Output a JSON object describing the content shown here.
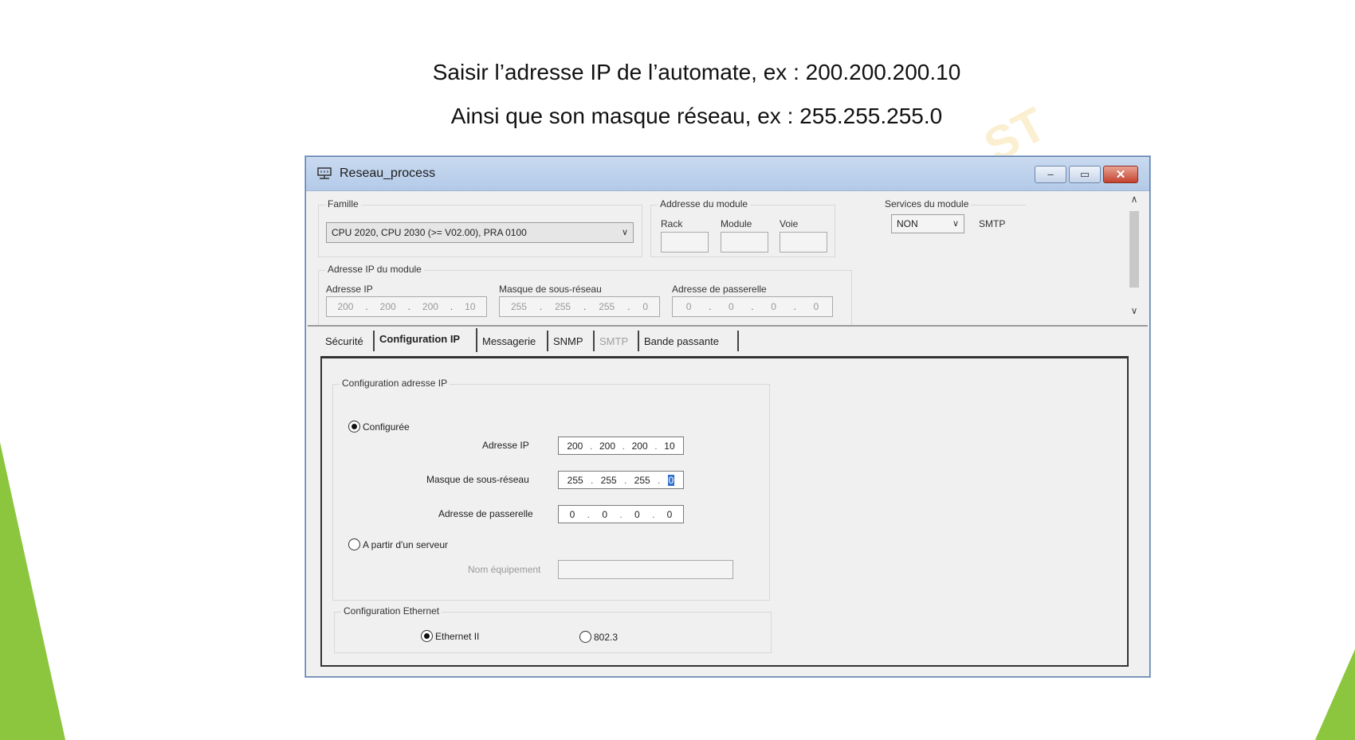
{
  "captions": {
    "line1": "Saisir l’adresse IP de l’automate, ex : 200.200.200.10",
    "line2": "Ainsi que son masque réseau, ex : 255.255.255.0"
  },
  "window": {
    "title": "Reseau_process",
    "title_icon": "network-icon",
    "controls": {
      "minimize": "–",
      "maximize": "▭",
      "close": "✕"
    }
  },
  "module": {
    "famille_label": "Famille",
    "famille_value": "CPU 2020, CPU 2030 (>= V02.00), PRA 0100",
    "addr_label": "Addresse du module",
    "rack_label": "Rack",
    "module_label": "Module",
    "voie_label": "Voie",
    "services_label": "Services du module",
    "services_value": "NON",
    "smtp_label": "SMTP",
    "ip_group_label": "Adresse IP du module",
    "ip_label": "Adresse IP",
    "ip_value": [
      "200",
      "200",
      "200",
      "10"
    ],
    "mask_label": "Masque de sous-réseau",
    "mask_value": [
      "255",
      "255",
      "255",
      "0"
    ],
    "gw_label": "Adresse de passerelle",
    "gw_value": [
      "0",
      "0",
      "0",
      "0"
    ]
  },
  "tabs": [
    {
      "label": "Sécurité",
      "state": "normal"
    },
    {
      "label": "Configuration  IP",
      "state": "active"
    },
    {
      "label": "Messagerie",
      "state": "normal"
    },
    {
      "label": "SNMP",
      "state": "normal"
    },
    {
      "label": "SMTP",
      "state": "disabled"
    },
    {
      "label": "Bande passante",
      "state": "normal"
    }
  ],
  "ipconfig": {
    "group_label": "Configuration adresse IP",
    "configured_label": "Configurée",
    "configured_selected": true,
    "ip_label": "Adresse IP",
    "ip_value": [
      "200",
      "200",
      "200",
      "10"
    ],
    "mask_label": "Masque de sous-réseau",
    "mask_value": [
      "255",
      "255",
      "255",
      "0"
    ],
    "gw_label": "Adresse de passerelle",
    "gw_value": [
      "0",
      "0",
      "0",
      "0"
    ],
    "server_label": "A partir d'un serveur",
    "server_selected": false,
    "device_name_label": "Nom équipement",
    "device_name_value": ""
  },
  "ethernet": {
    "group_label": "Configuration Ethernet",
    "opt1_label": "Ethernet II",
    "opt1_selected": true,
    "opt2_label": "802.3",
    "opt2_selected": false
  },
  "watermark_text": "ST",
  "colors": {
    "decor_green": "#8cc63f",
    "title_bar": "#b9cfea",
    "close": "#c4432f",
    "selection": "#3370cc"
  }
}
